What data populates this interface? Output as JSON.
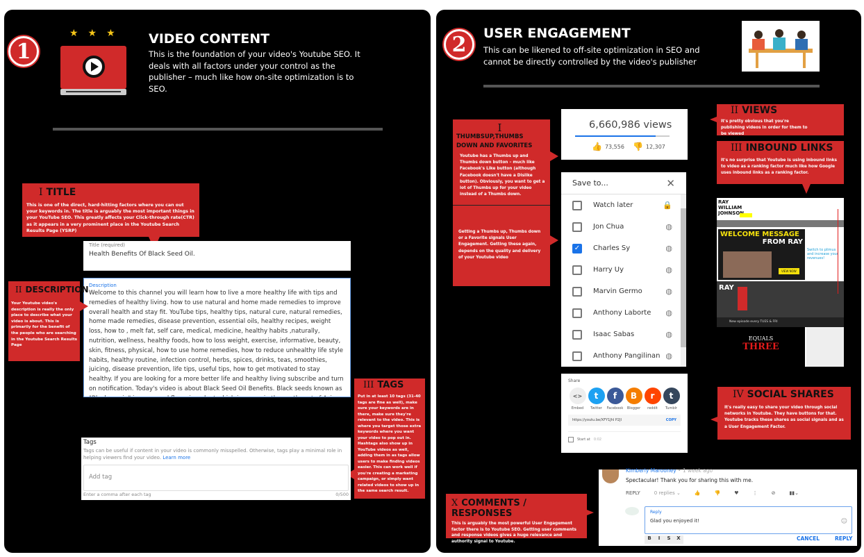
{
  "left": {
    "number": "1",
    "title": "VIDEO CONTENT",
    "intro": "This is the foundation of your video's Youtube SEO. It deals with all factors under your control as the publisher – much like how on-site optimization is to SEO.",
    "callouts": {
      "title": {
        "numeral": "I",
        "heading": "TITLE",
        "body": "This is one of the direct, hard-hitting factors where you can out your keywords in. The title is arguably the most important things in your YouTube SEO. This greatly affects your Click-through rate(CTR) as it appears in a very prominent place in the Youtube Search Results Page (YSRP)"
      },
      "description": {
        "numeral": "II",
        "heading": "DESCRIPTION",
        "body": "Your Youtube video's description is really the only place to describe what your video is about. This is primarily for the benefit of the people who are searching in the Youtube Search Results Page"
      },
      "tags": {
        "numeral": "III",
        "heading": "TAGS",
        "body": "Put in at least 10 tags (31-40 tags are fine as well), make sure your keywords are in there, make sure they're relevant to the video. This is where you target those extra keywords where you want your video to pop out in. Hashtags also show up in YouTube videos as well, adding them in as tags allow users to make finding videos easier. This can work well if you're creating a marketing campaign, or simply want related videos to show up in the same search result."
      }
    },
    "form": {
      "title_label": "Title (required)",
      "title_value": "Health Benefits Of Black Seed Oil.",
      "description_label": "Description",
      "description_value": "Welcome to this channel you will learn how to live a more healthy life with tips and remedies of healthy living. how to use natural and home made remedies to improve overall health  and stay fit. YouTube tips, healthy tips, natural cure, natural remedies, home made remedies, disease prevention, essential oils, healthy recipes, weight loss, how to , melt fat, self care, medical, medicine, healthy habits ,naturally, nutrition, wellness, healthy foods, how to loss weight, exercise, informative, beauty, skin, fitness, physical, how to use home remedies, how to reduce unhealthy life style habits, healthy routine, infection control, herbs, spices, drinks, teas, smoothies, juicing, disease prevention, life tips, useful tips, how to get motivated to stay healthy. If you are looking for a more better life and healthy living subscribe and turn on notification. Today's video is about  Black Seed  Oil Benefits. Black seeds known as \"Black cumin\" is an annual flowering plant which is grown in the southwest of Asia, these seeds stores million",
      "tags_label": "Tags",
      "tags_help": "Tags can be useful if content in your video is commonly misspelled. Otherwise, tags play a minimal role in helping viewers find your video.",
      "learn_more": "Learn more",
      "tags_placeholder": "Add tag",
      "tags_hint": "Enter a comma after each tag",
      "tags_count": "0/500"
    }
  },
  "right": {
    "number": "2",
    "title": "USER ENGAGEMENT",
    "intro": "This can be likened to off-site optimization in SEO and cannot be directly controlled by the video's publisher",
    "callouts": {
      "thumbs": {
        "numeral": "I",
        "heading": "THUMBSUP,THUMBS DOWN AND FAVORITES",
        "body": "Youtube has a Thumbs up and Thumbs down button – much like Facebook's Like button (although Facebook doesn't have a Dislike button). Obviously, you want to get a lot of Thumbs up for your video instead of a Thumbs down.",
        "body2": "Getting a Thumbs up, Thumbs down or a Favorite signals User Engagement. Getting these again, depends on the quality and delivery of your Youtube video"
      },
      "views": {
        "numeral": "II",
        "heading": "VIEWS",
        "body": "It's pretty obvious that you're publishing videos in order for them to be viewed"
      },
      "inbound": {
        "numeral": "III",
        "heading": "INBOUND LINKS",
        "body": "It's no surprise that Youtube is using inbound links to video as a ranking factor much like how Google uses inbound links as a ranking factor."
      },
      "social": {
        "numeral": "IV",
        "heading": "SOCIAL SHARES",
        "body": "It's really easy to share your video through social networks in Youtube. They have buttons for that. Youtube tracks these shares as social signals and as a User Engagement Factor."
      },
      "comments": {
        "numeral": "X",
        "heading": "COMMENTS / RESPONSES",
        "body": "This is arguably the most powerful User Engagement factor there is to Youtube SEO. Getting user comments and response videos gives a huge relevance and authority signal to Youtube."
      }
    },
    "stats": {
      "views": "6,660,986 views",
      "likes": "73,556",
      "dislikes": "12,307",
      "like_ratio": 0.85
    },
    "save_to": {
      "title": "Save to...",
      "items": [
        {
          "label": "Watch later",
          "checked": false,
          "icon": "lock-icon"
        },
        {
          "label": "Jon Chua",
          "checked": false,
          "icon": "globe-icon"
        },
        {
          "label": "Charles Sy",
          "checked": true,
          "icon": "globe-icon"
        },
        {
          "label": "Harry Uy",
          "checked": false,
          "icon": "globe-icon"
        },
        {
          "label": "Marvin Germo",
          "checked": false,
          "icon": "globe-icon"
        },
        {
          "label": "Anthony Laborte",
          "checked": false,
          "icon": "globe-icon"
        },
        {
          "label": "Isaac Sabas",
          "checked": false,
          "icon": "globe-icon"
        },
        {
          "label": "Anthony Pangilinan",
          "checked": false,
          "icon": "globe-icon"
        }
      ]
    },
    "website": {
      "logo": "RAY WILLIAM JOHNSON",
      "banner": "WELCOME MESSAGE",
      "banner2": "FROM RAY",
      "view_now": "VIEW NOW",
      "ad": "Switch to plimus and increase your revenues!",
      "channel_tag": "New episode every TUES & FRI",
      "show_title": "EQUALS",
      "show_title2": "THREE"
    },
    "share": {
      "title": "Share",
      "targets": [
        {
          "label": "Embed",
          "glyph": "<>",
          "color": "#eeeeee"
        },
        {
          "label": "Twitter",
          "glyph": "t",
          "color": "#1da1f2"
        },
        {
          "label": "Facebook",
          "glyph": "f",
          "color": "#3b5998"
        },
        {
          "label": "Blogger",
          "glyph": "B",
          "color": "#f57d00"
        },
        {
          "label": "reddit",
          "glyph": "r",
          "color": "#ff4500"
        },
        {
          "label": "Tumblr",
          "glyph": "t",
          "color": "#35465c"
        }
      ],
      "url": "https://youtu.be/XFY1Jhl P2Jl",
      "copy": "COPY",
      "start_at": "Start at",
      "start_time": "0:02"
    },
    "comment": {
      "author": "Kimberly Marooney",
      "age": "1 week ago",
      "text": "Spectacular! Thank you for sharing this with me.",
      "reply": "REPLY",
      "replies": "0 replies",
      "reply_label": "Reply",
      "reply_value": "Glad you enjoyed it!",
      "cancel": "CANCEL",
      "submit": "REPLY",
      "format": [
        "B",
        "I",
        "S",
        "X"
      ]
    }
  },
  "colors": {
    "accent": "#d02a2a",
    "background": "#000000",
    "link": "#1a73e8"
  }
}
